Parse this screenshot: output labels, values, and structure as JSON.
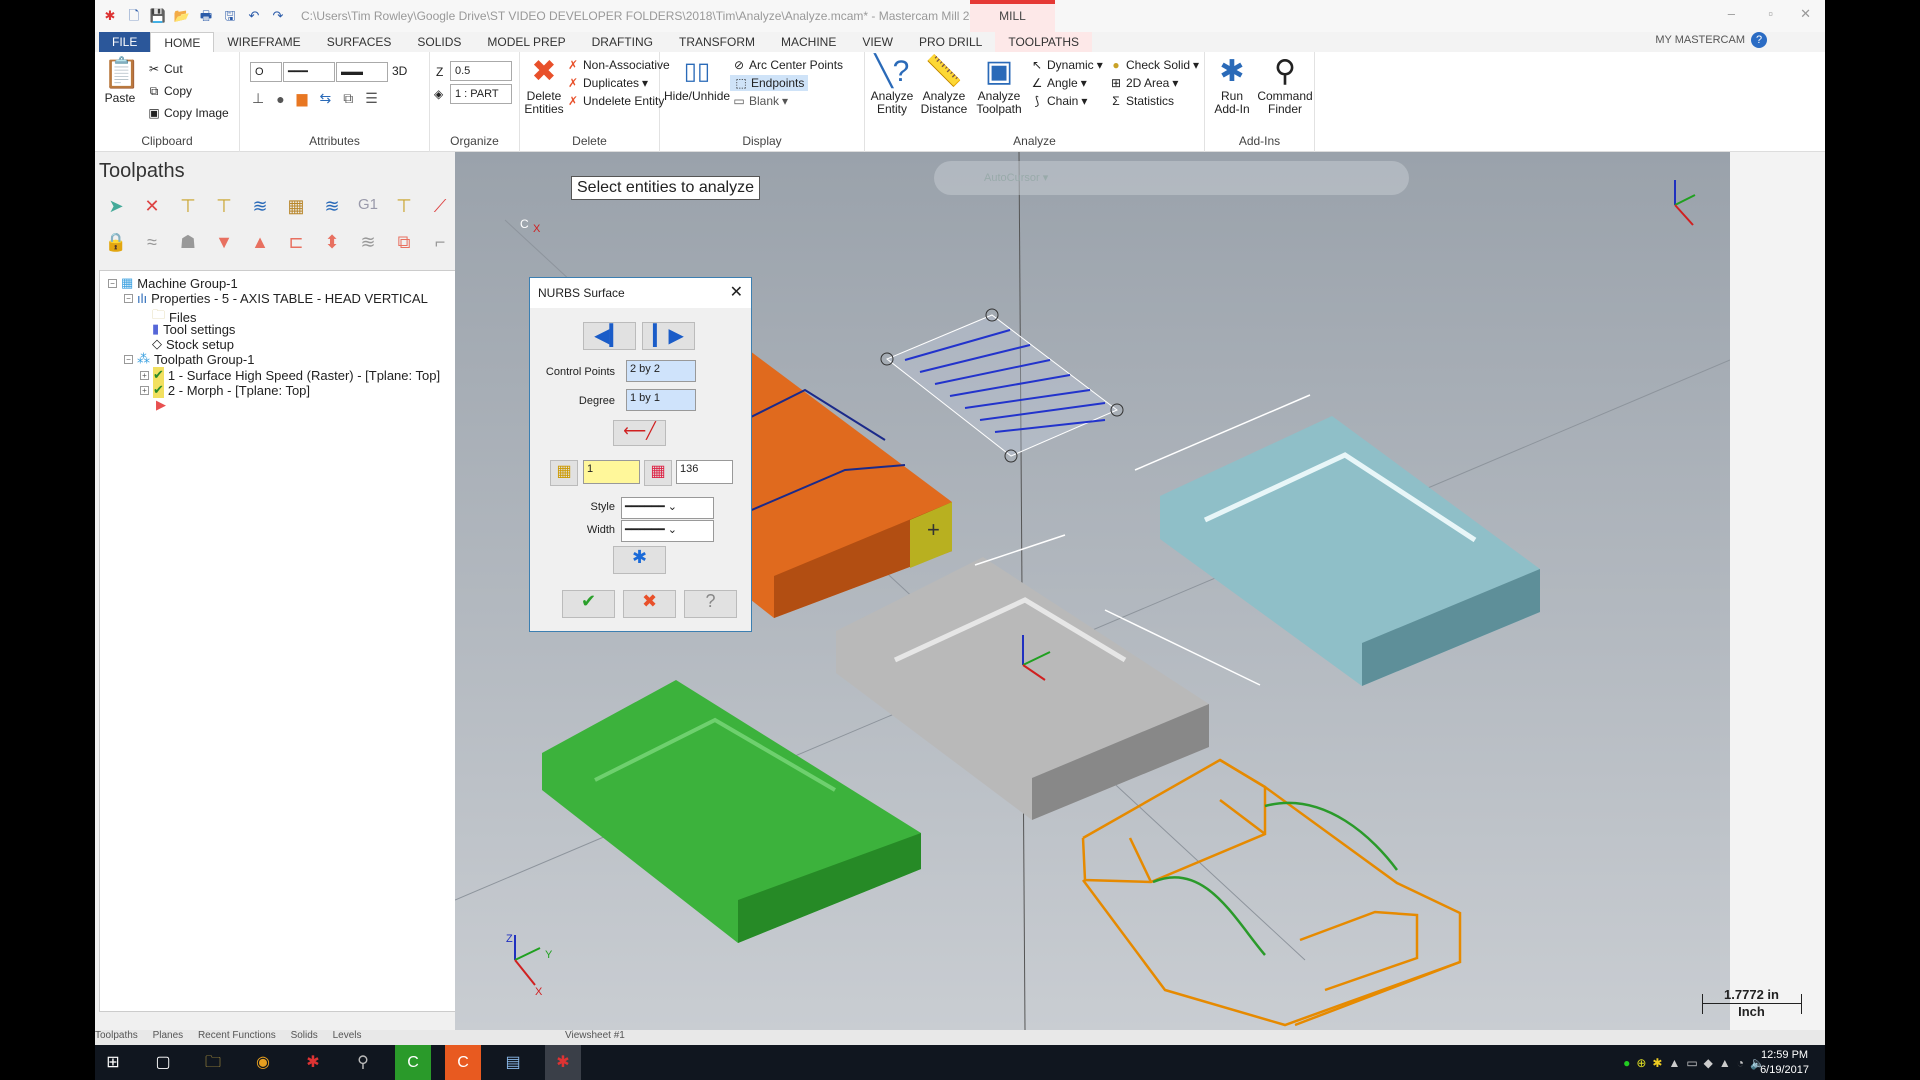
{
  "titlebar": {
    "title": "C:\\Users\\Tim Rowley\\Google Drive\\ST VIDEO DEVELOPER FOLDERS\\2018\\Tim\\Analyze\\Analyze.mcam* - Mastercam Mill 2018",
    "context": "MILL",
    "minimize": "–",
    "restore": "▫",
    "close": "✕"
  },
  "tabs": [
    "FILE",
    "HOME",
    "WIREFRAME",
    "SURFACES",
    "SOLIDS",
    "MODEL PREP",
    "DRAFTING",
    "TRANSFORM",
    "MACHINE",
    "VIEW",
    "PRO DRILL",
    "TOOLPATHS"
  ],
  "my_mastercam": "MY MASTERCAM",
  "ribbon": {
    "clipboard": {
      "label": "Clipboard",
      "paste": "Paste",
      "cut": "Cut",
      "copy": "Copy",
      "copy_image": "Copy Image"
    },
    "attributes": {
      "label": "Attributes",
      "point_style": "O",
      "mode": "3D"
    },
    "organize": {
      "label": "Organize",
      "z_label": "Z",
      "z_value": "0.5",
      "level": "1 : PART"
    },
    "delete": {
      "label": "Delete",
      "delete_entities": "Delete Entities",
      "non_associative": "Non-Associative",
      "duplicates": "Duplicates",
      "undelete": "Undelete Entity"
    },
    "display": {
      "label": "Display",
      "hide_unhide": "Hide/Unhide",
      "arc_center": "Arc Center Points",
      "endpoints": "Endpoints",
      "blank": "Blank"
    },
    "analyze": {
      "label": "Analyze",
      "entity": "Analyze Entity",
      "distance": "Analyze Distance",
      "toolpath": "Analyze Toolpath",
      "dynamic": "Dynamic",
      "angle": "Angle",
      "chain": "Chain",
      "check_solid": "Check Solid",
      "area_2d": "2D Area",
      "statistics": "Statistics"
    },
    "addins": {
      "label": "Add-Ins",
      "run": "Run Add-In",
      "finder": "Command Finder"
    }
  },
  "panel": {
    "title": "Toolpaths",
    "row1_icon_text": "G1",
    "tree": [
      "Machine Group-1",
      "Properties - 5 - AXIS TABLE - HEAD VERTICAL",
      "Files",
      "Tool settings",
      "Stock setup",
      "Toolpath Group-1",
      "1 - Surface High Speed (Raster) - [Tplane: Top]",
      "2 - Morph - [Tplane: Top]"
    ],
    "bottom_tabs": [
      "Toolpaths",
      "Planes",
      "Recent Functions",
      "Solids",
      "Levels"
    ]
  },
  "viewport": {
    "prompt": "Select entities to analyze",
    "autocursor": "AutoCursor",
    "sheet": "Viewsheet #1",
    "scale_value": "1.7772 in",
    "scale_unit": "Inch",
    "axis": {
      "x": "X",
      "y": "Y",
      "z": "Z",
      "c": "C"
    }
  },
  "dialog": {
    "title": "NURBS Surface",
    "control_points_label": "Control Points",
    "control_points": "2 by 2",
    "degree_label": "Degree",
    "degree": "1 by 1",
    "level": "1",
    "color": "136",
    "style_label": "Style",
    "width_label": "Width"
  },
  "taskbar": {
    "time": "12:59 PM",
    "date": "6/19/2017"
  },
  "colors": {
    "accent": "#2b579a",
    "orange_part": "#e06a1e",
    "green_part": "#3cb23c",
    "blue_part": "#8fbfc8",
    "gray_part": "#b9b9b9",
    "wireframe": "#e68a00",
    "mill_context": "#e53935"
  }
}
